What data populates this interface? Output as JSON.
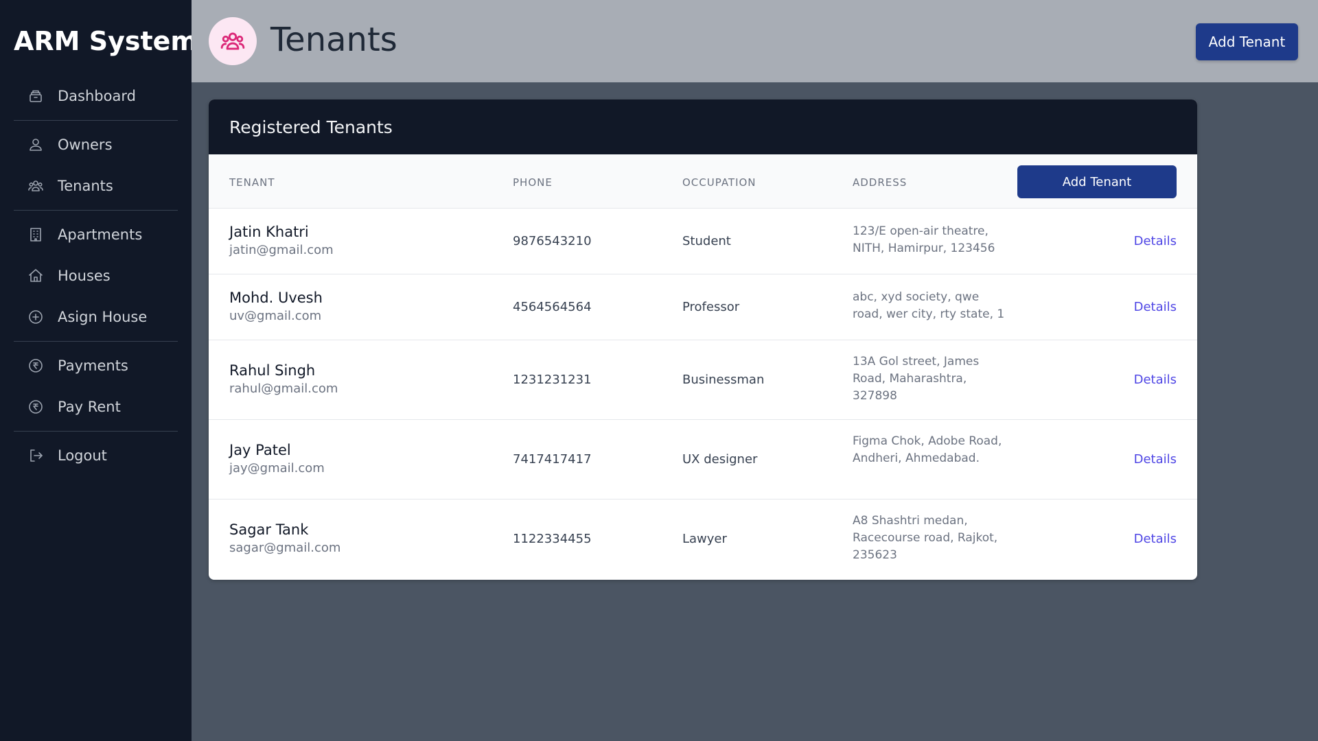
{
  "app": {
    "title": "ARM System"
  },
  "sidebar": {
    "items": [
      {
        "label": "Dashboard",
        "icon": "archive-icon"
      },
      {
        "label": "Owners",
        "icon": "users-icon"
      },
      {
        "label": "Tenants",
        "icon": "user-group-icon"
      },
      {
        "label": "Apartments",
        "icon": "building-icon"
      },
      {
        "label": "Houses",
        "icon": "home-icon"
      },
      {
        "label": "Asign House",
        "icon": "plus-circle-icon"
      },
      {
        "label": "Payments",
        "icon": "rupee-circle-icon"
      },
      {
        "label": "Pay Rent",
        "icon": "rupee-circle-icon"
      },
      {
        "label": "Logout",
        "icon": "logout-icon"
      }
    ]
  },
  "header": {
    "title": "Tenants",
    "icon": "user-group-icon",
    "add_button": "Add Tenant"
  },
  "card": {
    "title": "Registered Tenants",
    "columns": [
      "TENANT",
      "PHONE",
      "OCCUPATION",
      "ADDRESS"
    ],
    "add_button": "Add Tenant",
    "rows": [
      {
        "name": "Jatin Khatri",
        "email": "jatin@gmail.com",
        "phone": "9876543210",
        "occupation": "Student",
        "address": "123/E open-air theatre, NITH, Hamirpur, 123456",
        "action": "Details"
      },
      {
        "name": "Mohd. Uvesh",
        "email": "uv@gmail.com",
        "phone": "4564564564",
        "occupation": "Professor",
        "address": "abc, xyd society, qwe road, wer city, rty state, 1",
        "action": "Details"
      },
      {
        "name": "Rahul Singh",
        "email": "rahul@gmail.com",
        "phone": "1231231231",
        "occupation": "Businessman",
        "address": "13A Gol street, James Road, Maharashtra, 327898",
        "action": "Details"
      },
      {
        "name": "Jay Patel",
        "email": "jay@gmail.com",
        "phone": "7417417417",
        "occupation": "UX designer",
        "address": "Figma Chok, Adobe Road, Andheri, Ahmedabad.",
        "action": "Details"
      },
      {
        "name": "Sagar Tank",
        "email": "sagar@gmail.com",
        "phone": "1122334455",
        "occupation": "Lawyer",
        "address": "A8 Shashtri medan, Racecourse road, Rajkot, 235623",
        "action": "Details"
      }
    ]
  },
  "colors": {
    "sidebar_bg": "#111827",
    "header_bg": "#a8adb5",
    "main_bg": "#4b5563",
    "primary_button": "#1e3a8a",
    "link": "#4f46e5",
    "tenant_icon": "#db2777"
  }
}
